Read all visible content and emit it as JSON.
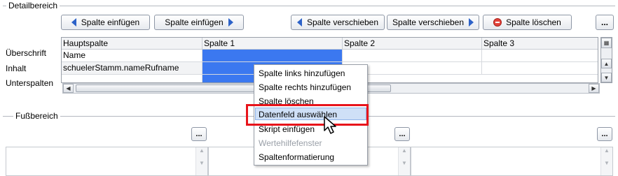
{
  "detail": {
    "title": "Detailbereich",
    "buttons": {
      "insert_left": "Spalte einfügen",
      "insert_right": "Spalte einfügen",
      "move_left": "Spalte verschieben",
      "move_right": "Spalte verschieben",
      "delete": "Spalte löschen",
      "more": "..."
    },
    "row_labels": {
      "header": "Überschrift",
      "content": "Inhalt",
      "subcolumns": "Unterspalten"
    },
    "grid": {
      "columns": [
        "Hauptspalte",
        "Spalte 1",
        "Spalte 2",
        "Spalte 3"
      ],
      "row_header": [
        "Name",
        "",
        "",
        ""
      ],
      "row_content": [
        "schuelerStamm.nameRufname",
        "",
        "",
        ""
      ]
    }
  },
  "footer": {
    "title": "Fußbereich",
    "buttons": [
      "...",
      "...",
      "..."
    ]
  },
  "context_menu": {
    "items": [
      {
        "label": "Spalte links hinzufügen",
        "enabled": true
      },
      {
        "label": "Spalte rechts hinzufügen",
        "enabled": true
      },
      {
        "label": "Spalte löschen",
        "enabled": true
      },
      {
        "label": "Datenfeld auswählen",
        "enabled": true,
        "highlighted": true
      },
      {
        "label": "Skript einfügen",
        "enabled": true
      },
      {
        "label": "Wertehilfefenster",
        "enabled": false
      },
      {
        "label": "Spaltenformatierung",
        "enabled": true
      }
    ]
  },
  "colors": {
    "selection": "#3b78f0",
    "highlight_box": "#e8141b",
    "arrow": "#2d62c8"
  }
}
